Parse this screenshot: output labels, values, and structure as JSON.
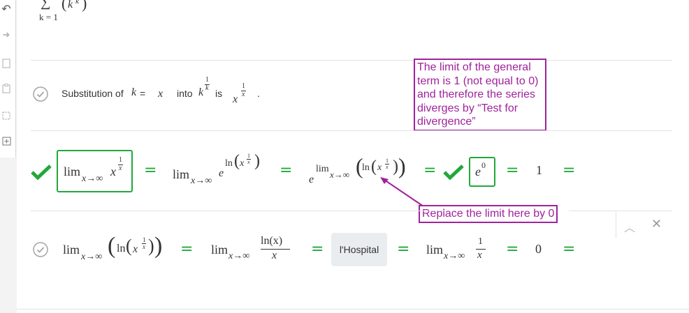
{
  "toolbar": {
    "icons": [
      "undo-icon",
      "redo-icon",
      "copy-icon",
      "paste-icon",
      "select-icon",
      "insert-icon"
    ]
  },
  "top_expression": {
    "sum_symbol": "∑",
    "sum_lower": "k = 1",
    "term_open": "(",
    "term_base": "k",
    "term_exp": "k",
    "term_close": ")"
  },
  "substitution_row": {
    "text_prefix": "Substitution of",
    "var": "k",
    "eq": "=",
    "value": "x",
    "text_into": "into",
    "expr_base": "k",
    "expr_exp_num": "1",
    "expr_exp_den": "k",
    "text_is": "is",
    "result_base": "x",
    "result_exp_num": "1",
    "result_exp_den": "x",
    "period": "."
  },
  "note_divergence": {
    "text": "The limit of the general term is 1 (not equal to 0) and therefore the series diverges by “Test for divergence”",
    "color": "#a0229c"
  },
  "note_replace": {
    "text": "Replace the limit here by 0",
    "color": "#a0229c"
  },
  "limit_row": {
    "lim": "lim",
    "sub": "x→∞",
    "step1_base": "x",
    "step1_exp_num": "1",
    "step1_exp_den": "x",
    "eq": "=",
    "step2_e": "e",
    "step2_ln": "ln",
    "step2_x": "x",
    "step3_e": "e",
    "step3_ln": "ln",
    "step3_x": "x",
    "e0_base": "e",
    "e0_exp": "0",
    "one": "1"
  },
  "lhospital_row": {
    "lim": "lim",
    "sub": "x→∞",
    "ln": "ln",
    "x": "x",
    "frac_num": "ln(x)",
    "frac_den": "x",
    "button_label": "l'Hospital",
    "frac2_num": "1",
    "frac2_den": "x",
    "zero": "0",
    "eq": "="
  },
  "colors": {
    "green": "#22a83a",
    "purple": "#a0229c",
    "gray_check": "#9a9a9a"
  }
}
